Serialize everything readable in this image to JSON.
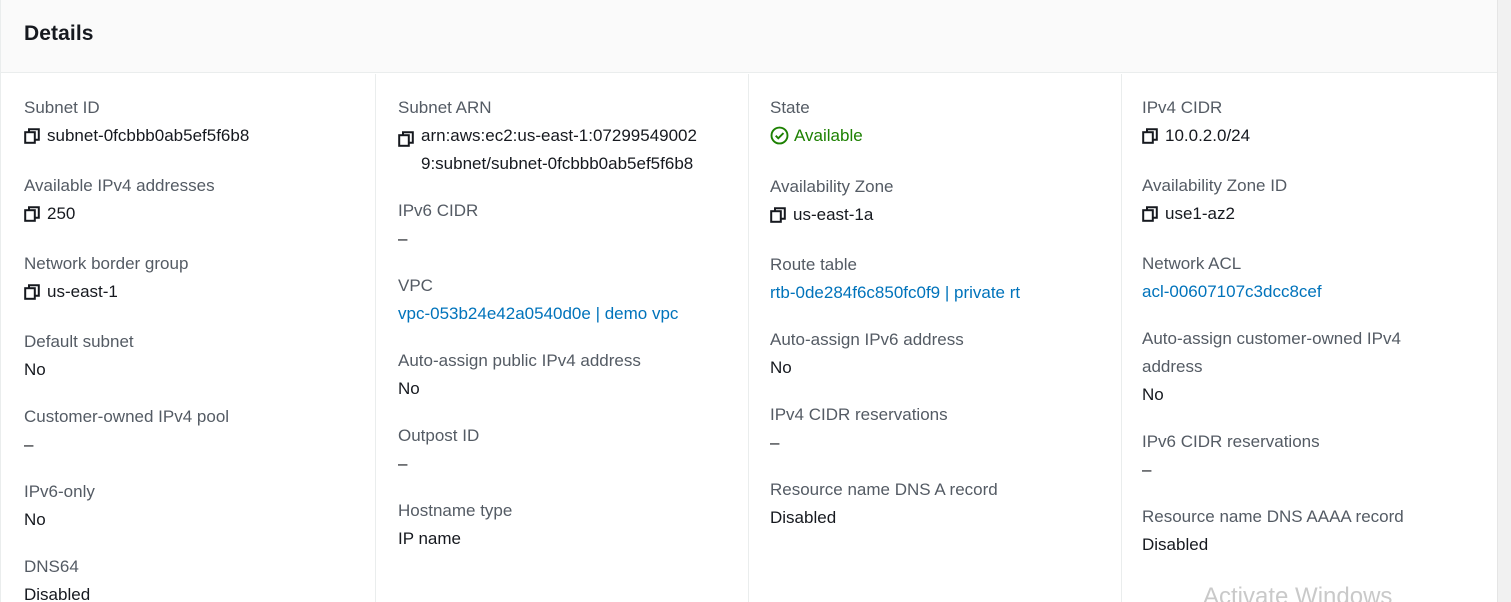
{
  "header": {
    "title": "Details"
  },
  "col1": [
    {
      "label": "Subnet ID",
      "value": "subnet-0fcbbb0ab5ef5f6b8"
    },
    {
      "label": "Available IPv4 addresses",
      "value": "250"
    },
    {
      "label": "Network border group",
      "value": "us-east-1"
    },
    {
      "label": "Default subnet",
      "value": "No"
    },
    {
      "label": "Customer-owned IPv4 pool",
      "value": "–"
    },
    {
      "label": "IPv6-only",
      "value": "No"
    },
    {
      "label": "DNS64",
      "value": "Disabled"
    }
  ],
  "col2": [
    {
      "label": "Subnet ARN",
      "value": "arn:aws:ec2:us-east-1:072995490029:subnet/subnet-0fcbbb0ab5ef5f6b8"
    },
    {
      "label": "IPv6 CIDR",
      "value": "–"
    },
    {
      "label": "VPC",
      "value": "vpc-053b24e42a0540d0e | demo vpc"
    },
    {
      "label": "Auto-assign public IPv4 address",
      "value": "No"
    },
    {
      "label": "Outpost ID",
      "value": "–"
    },
    {
      "label": "Hostname type",
      "value": "IP name"
    }
  ],
  "col3": [
    {
      "label": "State",
      "value": "Available"
    },
    {
      "label": "Availability Zone",
      "value": "us-east-1a"
    },
    {
      "label": "Route table",
      "value": "rtb-0de284f6c850fc0f9 | private rt"
    },
    {
      "label": "Auto-assign IPv6 address",
      "value": "No"
    },
    {
      "label": "IPv4 CIDR reservations",
      "value": "–"
    },
    {
      "label": "Resource name DNS A record",
      "value": "Disabled"
    }
  ],
  "col4": [
    {
      "label": "IPv4 CIDR",
      "value": "10.0.2.0/24"
    },
    {
      "label": "Availability Zone ID",
      "value": "use1-az2"
    },
    {
      "label": "Network ACL",
      "value": "acl-00607107c3dcc8cef"
    },
    {
      "label": "Auto-assign customer-owned IPv4 address",
      "value": "No"
    },
    {
      "label": "IPv6 CIDR reservations",
      "value": "–"
    },
    {
      "label": "Resource name DNS AAAA record",
      "value": "Disabled"
    }
  ],
  "watermark": "Activate Windows",
  "colors": {
    "link": "#0073bb",
    "success": "#1d8102",
    "label": "#545b64"
  },
  "icons": {
    "copy": "copy-icon",
    "status": "check-circle-icon"
  }
}
